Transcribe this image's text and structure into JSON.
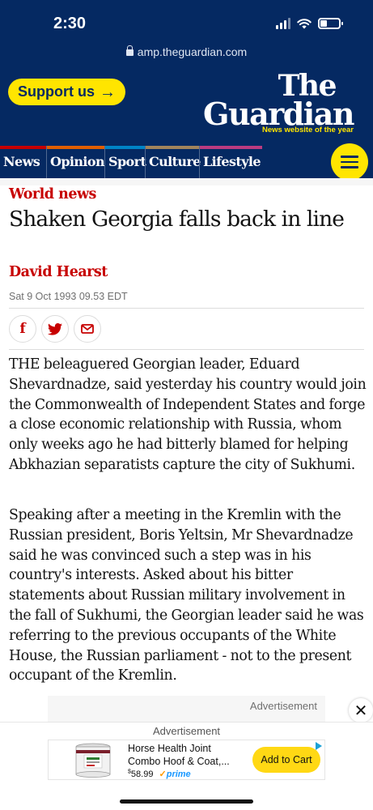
{
  "status_bar": {
    "time": "2:30"
  },
  "browser": {
    "url": "amp.theguardian.com"
  },
  "header": {
    "support_label": "Support us",
    "logo_line1": "The",
    "logo_line2": "Guardian",
    "logo_tagline": "News website of the year",
    "nav": [
      {
        "label": "News",
        "color": "#c70000"
      },
      {
        "label": "Opinion",
        "color": "#e05e00"
      },
      {
        "label": "Sport",
        "color": "#0084c6"
      },
      {
        "label": "Culture",
        "color": "#a1845c"
      },
      {
        "label": "Lifestyle",
        "color": "#bb3b80"
      }
    ]
  },
  "article": {
    "section": "World news",
    "headline": "Shaken Georgia falls back in line",
    "byline": "David Hearst",
    "date": "Sat 9 Oct 1993 09.53 EDT",
    "paragraphs": [
      "THE beleaguered Georgian leader, Eduard Shevardnadze, said yesterday his country would join the Commonwealth of Independent States and forge a close economic relationship with Russia, whom only weeks ago he had bitterly blamed for helping Abkhazian separatists capture the city of Sukhumi.",
      "Speaking after a meeting in the Kremlin with the Russian president, Boris Yeltsin, Mr Shevardnadze said he was convinced such a step was in his country's interests. Asked about his bitter statements about Russian military involvement in the fall of Sukhumi, the Georgian leader said he was referring to the previous occupants of the White House, the Russian parliament - not to the present occupant of the Kremlin."
    ]
  },
  "ads": {
    "inline_label": "Advertisement",
    "sticky_label": "Advertisement",
    "product_title": "Horse Health Joint Combo Hoof & Coat,...",
    "price_symbol": "$",
    "price": "58.99",
    "prime_label": "prime",
    "cta_label": "Add to Cart"
  }
}
